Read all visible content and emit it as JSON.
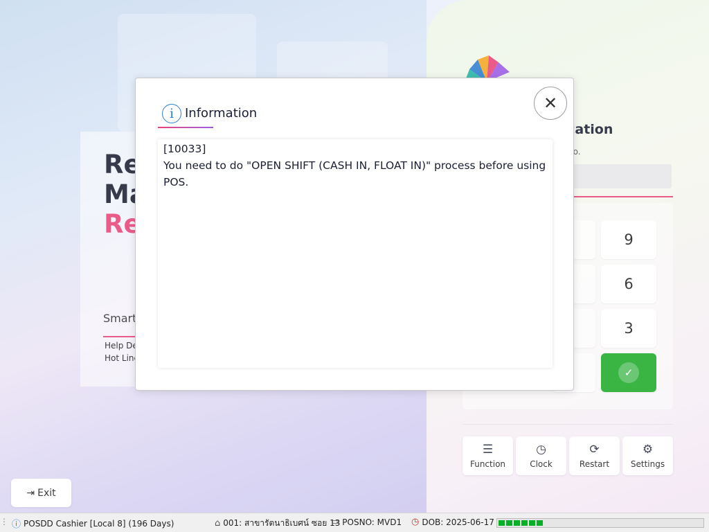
{
  "background": {
    "hero_lines": [
      "Re",
      "Ma",
      "Re"
    ],
    "tagline": "Smart",
    "help_lines": [
      "Help De",
      "Hot Line"
    ],
    "auth_title": "ntication",
    "auth_subtitle": "no.",
    "keypad_keys": [
      "9",
      "6",
      "3"
    ],
    "ok_icon": "check-icon",
    "function_buttons": [
      {
        "label": "Function",
        "icon": "menu-icon"
      },
      {
        "label": "Clock",
        "icon": "clock-icon"
      },
      {
        "label": "Restart",
        "icon": "refresh-icon"
      },
      {
        "label": "Settings",
        "icon": "gear-icon"
      }
    ],
    "exit_label": "Exit",
    "accent_color": "#e8457a",
    "ok_color": "#1fab2b"
  },
  "dialog": {
    "title": "Information",
    "message_code": "[10033]",
    "message_text": "You need to do \"OPEN SHIFT (CASH IN, FLOAT IN)\" process before using POS."
  },
  "statusbar": {
    "app_info": "POSDD Cashier [Local 8] (196 Days)",
    "branch": "001: สาขารัตนาธิเบศน์ ซอย 13",
    "posno": "POSNO: MVD1",
    "dob": "DOB: 2025-06-17",
    "progress_fraction": 0.22,
    "progress_color": "#06b025"
  }
}
